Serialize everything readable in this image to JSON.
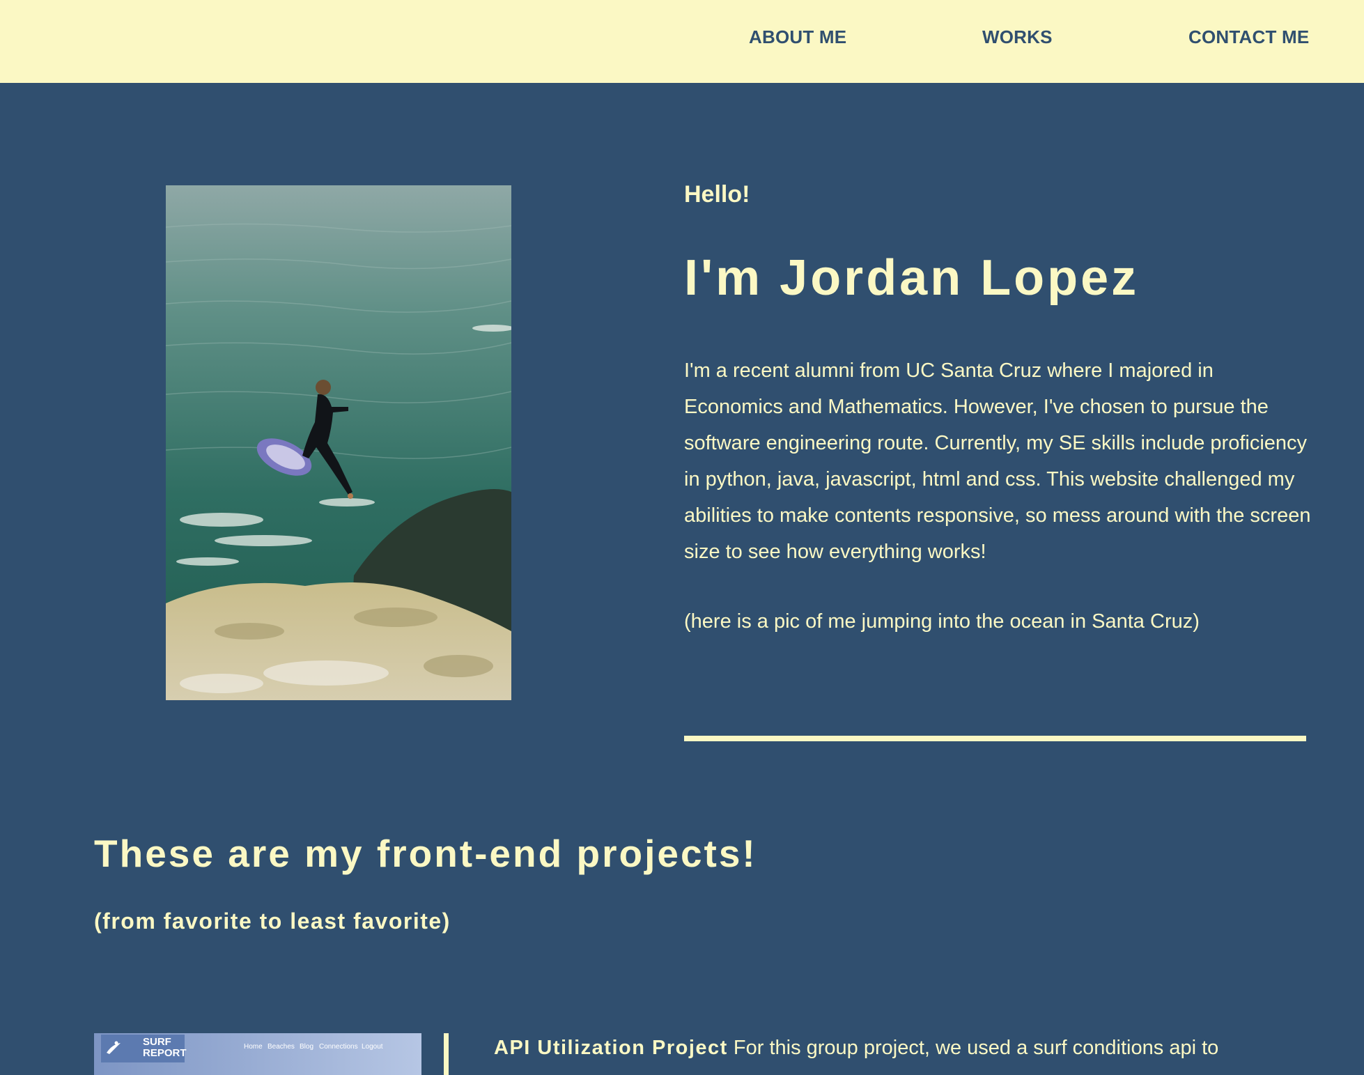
{
  "nav": {
    "about": "ABOUT ME",
    "works": "WORKS",
    "contact": "CONTACT ME"
  },
  "hero": {
    "greeting": "Hello!",
    "name": "I'm Jordan Lopez",
    "bio": "I'm a recent alumni from UC Santa Cruz where I majored in Economics and Mathematics. However, I've chosen to pursue the software engineering route. Currently, my SE skills include proficiency in python, java, javascript, html and css. This website challenged my abilities to make contents responsive, so mess around with the screen size to see how everything works!",
    "photo_caption": "(here is a pic of me jumping into the ocean in Santa Cruz)"
  },
  "projects": {
    "heading": "These are my front-end projects!",
    "subheading": "(from favorite to least favorite)",
    "items": [
      {
        "title": "API Utilization Project",
        "description": "For this group project, we used a surf conditions api to",
        "thumbnail": {
          "logo_text": "SURF\nREPORT",
          "nav": [
            "Home",
            "Beaches",
            "Blog",
            "Connections",
            "Logout"
          ]
        }
      }
    ]
  },
  "colors": {
    "background": "#304f6f",
    "accent": "#fbf8c4"
  }
}
